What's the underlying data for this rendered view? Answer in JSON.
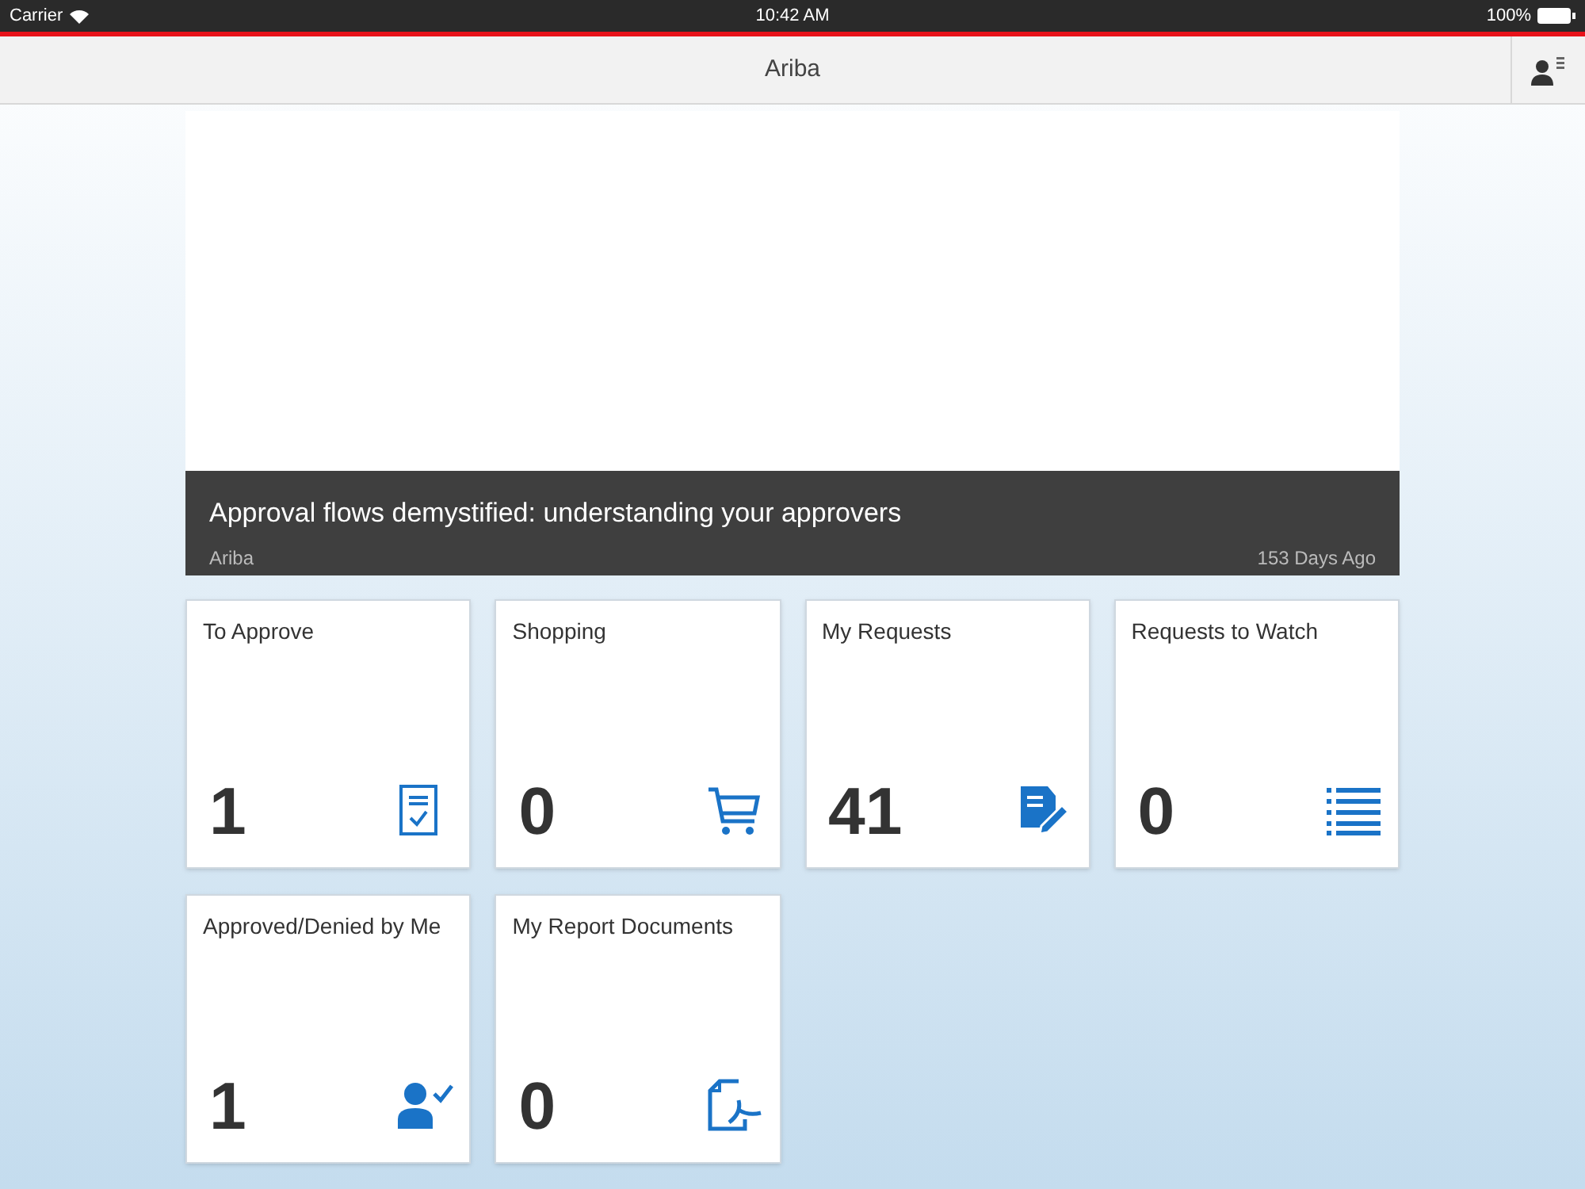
{
  "status_bar": {
    "carrier": "Carrier",
    "time": "10:42 AM",
    "battery": "100%"
  },
  "nav_bar": {
    "title": "Ariba"
  },
  "news": {
    "headline": "Approval flows demystified: understanding your approvers",
    "source": "Ariba",
    "age": "153 Days Ago"
  },
  "tiles": [
    {
      "title": "To Approve",
      "count": "1",
      "kind": "approve"
    },
    {
      "title": "Shopping",
      "count": "0",
      "kind": "cart"
    },
    {
      "title": "My Requests",
      "count": "41",
      "kind": "edit"
    },
    {
      "title": "Requests to Watch",
      "count": "0",
      "kind": "list"
    },
    {
      "title": "Approved/Denied by Me",
      "count": "1",
      "kind": "person"
    },
    {
      "title": "My Report Documents",
      "count": "0",
      "kind": "pdf"
    }
  ]
}
